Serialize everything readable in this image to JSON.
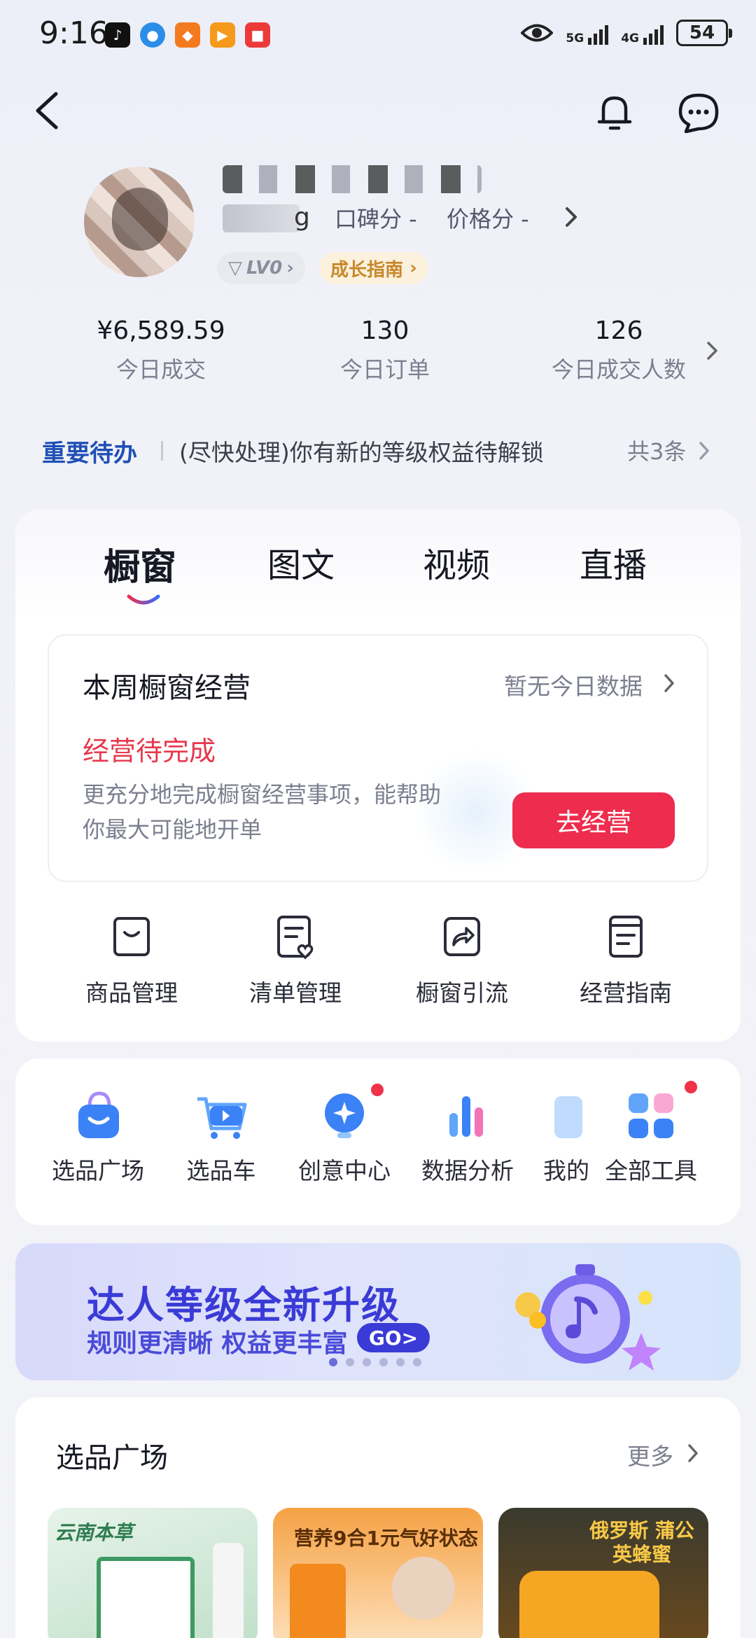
{
  "status_bar": {
    "time": "9:16",
    "signal1": "5G",
    "signal2": "4G",
    "battery": "54"
  },
  "profile": {
    "name_tail": "g",
    "koubei_label": "口碑分 -",
    "price_label": "价格分 -",
    "level": "LV0",
    "growth_guide": "成长指南"
  },
  "stats": [
    {
      "value": "¥6,589.59",
      "label": "今日成交"
    },
    {
      "value": "130",
      "label": "今日订单"
    },
    {
      "value": "126",
      "label": "今日成交人数"
    }
  ],
  "todo": {
    "title": "重要待办",
    "text": "(尽快处理)你有新的等级权益待解锁",
    "count": "共3条"
  },
  "tabs": [
    "橱窗",
    "图文",
    "视频",
    "直播"
  ],
  "business": {
    "title": "本周橱窗经营",
    "no_data": "暂无今日数据",
    "status": "经营待完成",
    "desc": "更充分地完成橱窗经营事项，能帮助你最大可能地开单",
    "button": "去经营"
  },
  "tools": [
    "商品管理",
    "清单管理",
    "橱窗引流",
    "经营指南"
  ],
  "quick_tools": [
    "选品广场",
    "选品车",
    "创意中心",
    "数据分析",
    "我的",
    "全部工具"
  ],
  "banner": {
    "title": "达人等级全新升级",
    "subtitle": "规则更清晰 权益更丰富",
    "go": "GO>"
  },
  "square": {
    "title": "选品广场",
    "more": "更多",
    "products": [
      {
        "label": "云南本草"
      },
      {
        "label": "营养9合1元气好状态"
      },
      {
        "label": "俄罗斯 蒲公英蜂蜜"
      }
    ]
  },
  "colors": {
    "accent_red": "#ee2d4e",
    "todo_blue": "#1f4fb5",
    "banner_purple": "#3a3bd6"
  }
}
